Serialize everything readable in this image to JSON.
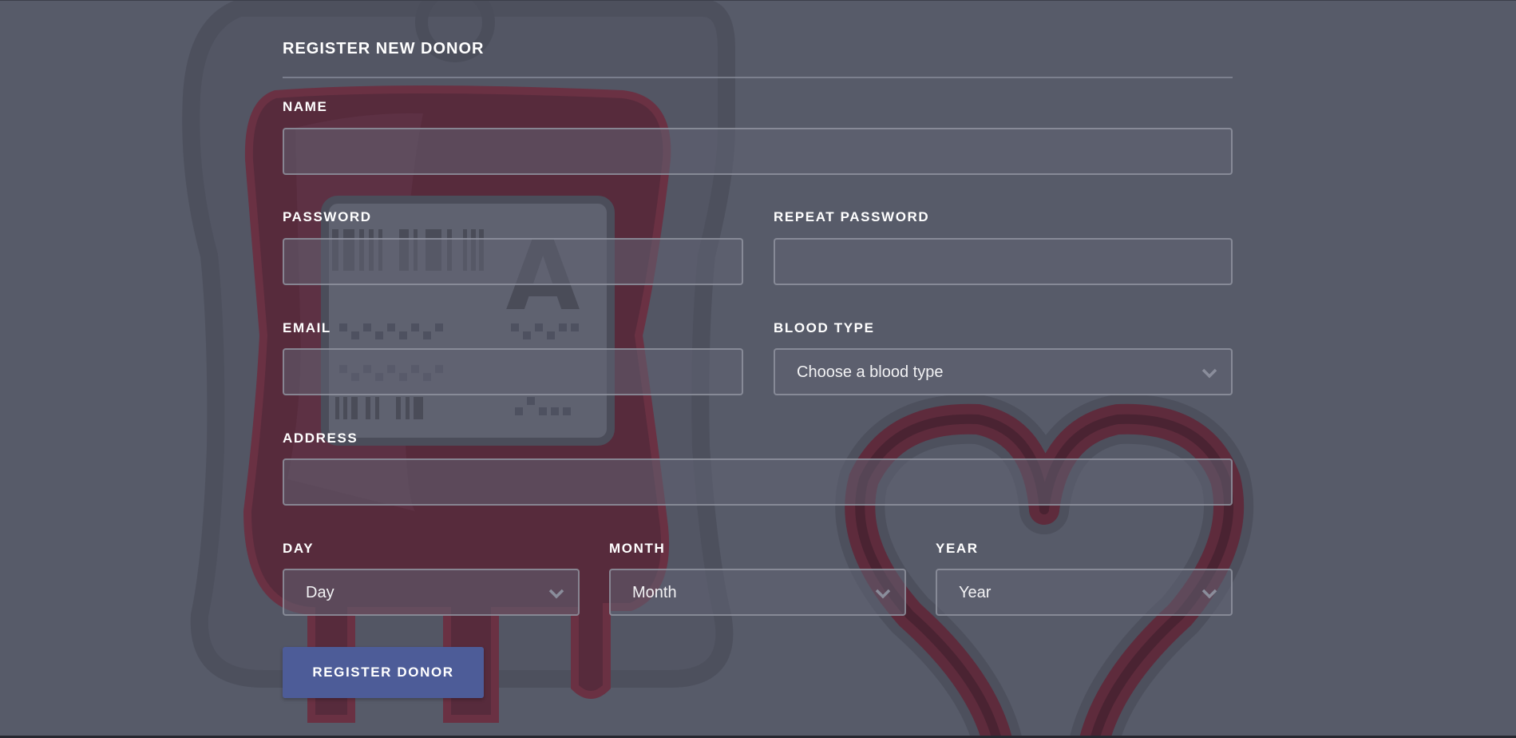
{
  "form": {
    "title": "REGISTER NEW DONOR",
    "labels": {
      "name": "NAME",
      "password": "PASSWORD",
      "repeat_password": "REPEAT PASSWORD",
      "email": "EMAIL",
      "blood_type": "BLOOD TYPE",
      "address": "ADDRESS",
      "day": "DAY",
      "month": "MONTH",
      "year": "YEAR"
    },
    "values": {
      "name": "",
      "password": "",
      "repeat_password": "",
      "email": "",
      "address": ""
    },
    "selects": {
      "blood_type": "Choose a blood type",
      "day": "Day",
      "month": "Month",
      "year": "Year"
    },
    "submit_label": "REGISTER DONOR"
  },
  "background": {
    "blood_bag_label": "A"
  },
  "colors": {
    "page_background": "#575b69",
    "blood_red": "#5c2436",
    "button_blue": "#4d5c98",
    "field_border": "#9699a6"
  }
}
